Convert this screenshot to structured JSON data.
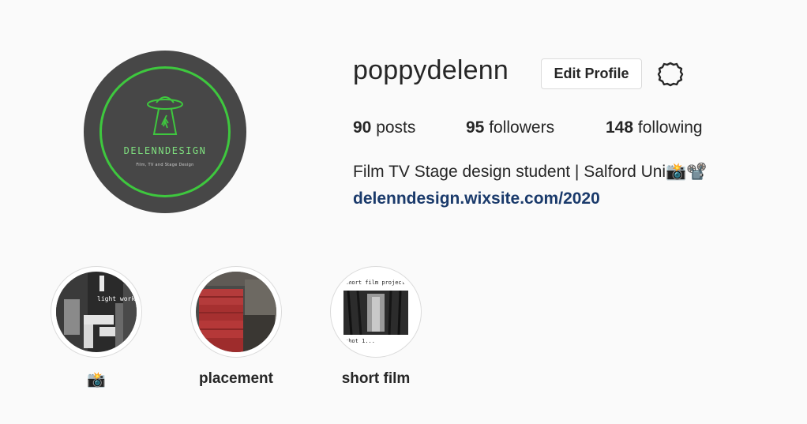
{
  "profile": {
    "username": "poppydelenn",
    "edit_label": "Edit Profile",
    "avatar": {
      "brand": "DELENNDESIGN",
      "tagline": "Film, TV and Stage Design"
    },
    "stats": {
      "posts_count": "90",
      "posts_label": "posts",
      "followers_count": "95",
      "followers_label": "followers",
      "following_count": "148",
      "following_label": "following"
    },
    "bio": "Film TV Stage design student | Salford Uni📸📽️",
    "link": "delenndesign.wixsite.com/2020"
  },
  "highlights": [
    {
      "label": "📸",
      "thumb_text": "light work"
    },
    {
      "label": "placement"
    },
    {
      "label": "short film",
      "thumb_title": "short film project",
      "thumb_caption": "shot 1..."
    }
  ],
  "colors": {
    "background": "#fafafa",
    "avatar_bg": "#474747",
    "avatar_ring": "#3ec83e",
    "link": "#1a3a6b"
  }
}
